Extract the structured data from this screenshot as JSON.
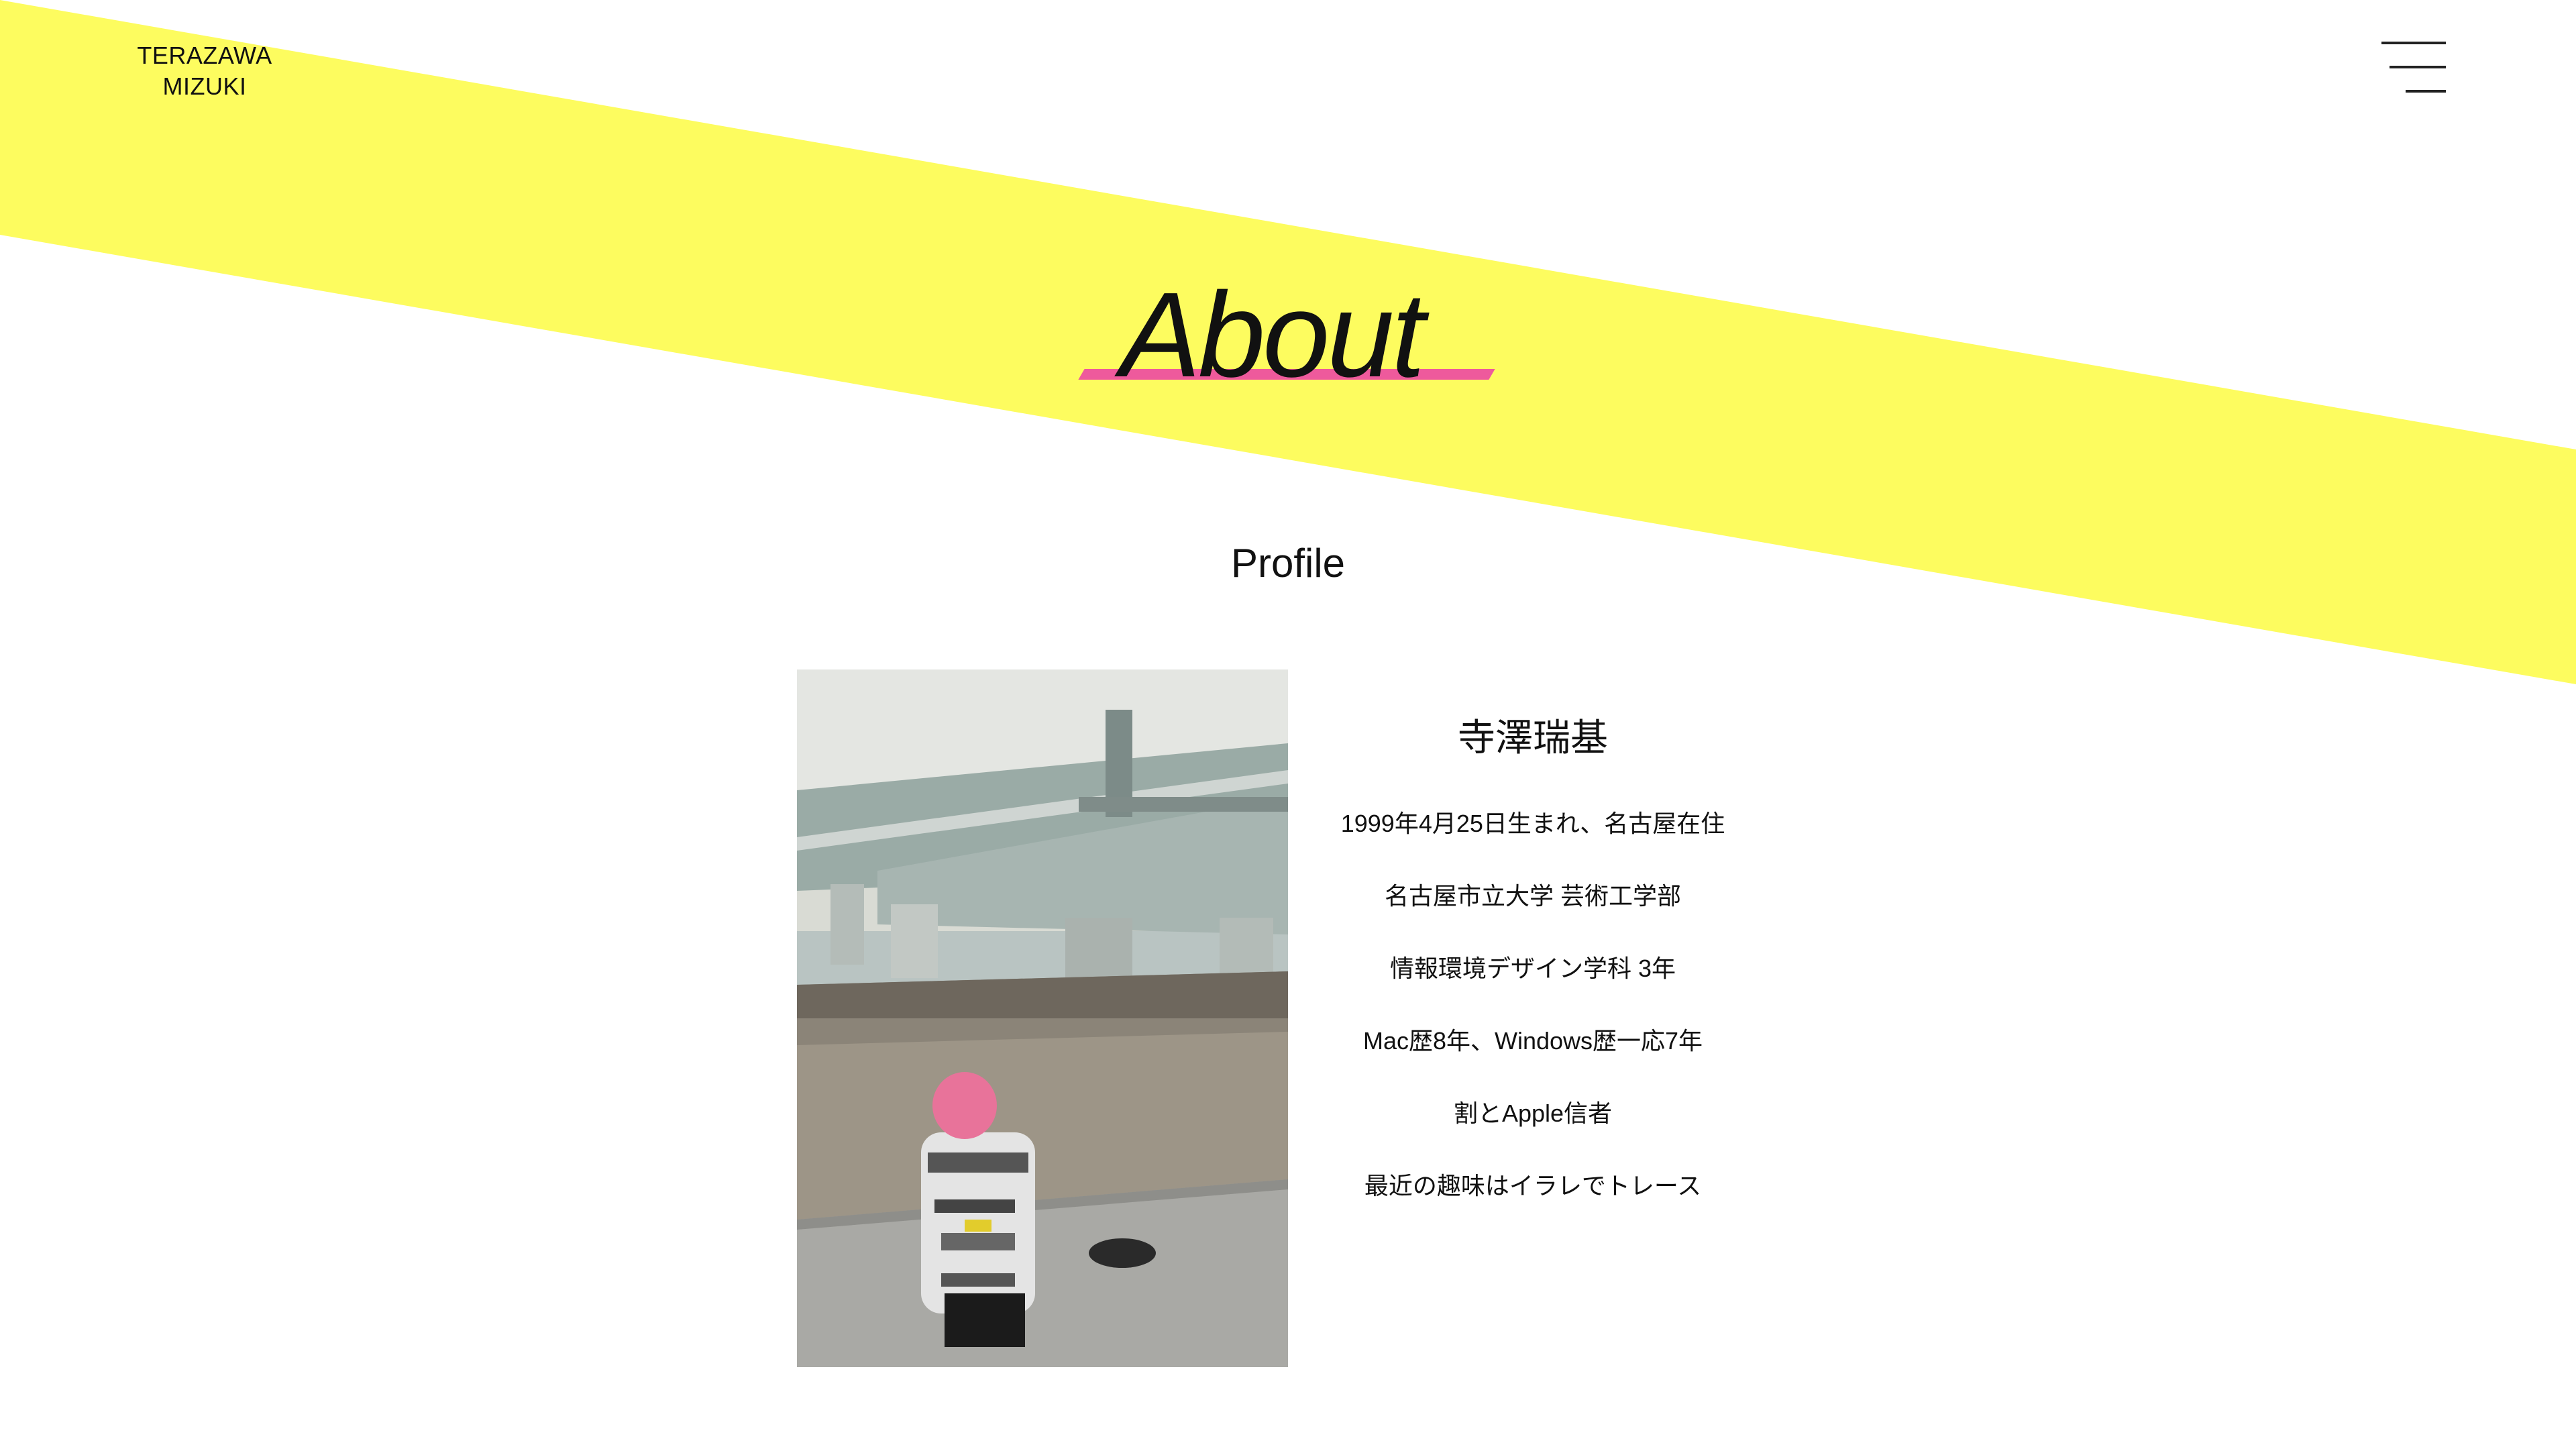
{
  "header": {
    "logo_line1": "TERAZAWA",
    "logo_line2": "MIZUKI",
    "menu_icon": "hamburger-menu-icon"
  },
  "hero": {
    "title": "About"
  },
  "profile": {
    "heading": "Profile",
    "name": "寺澤瑞基",
    "lines": [
      "1999年4月25日生まれ、名古屋在住",
      "名古屋市立大学 芸術工学部",
      "情報環境デザイン学科 3年",
      "Mac歴8年、Windows歴一応7年",
      "割とApple信者",
      "最近の趣味はイラレでトレース"
    ]
  },
  "colors": {
    "band": "#fdfc5f",
    "accent_underline": "#ee5a9c",
    "text": "#111111",
    "background": "#ffffff"
  }
}
